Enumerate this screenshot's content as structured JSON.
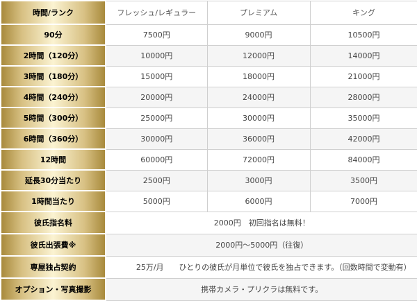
{
  "header": {
    "corner": "時間/ランク",
    "columns": [
      "フレッシュ/レギュラー",
      "プレミアム",
      "キング"
    ]
  },
  "rows": [
    {
      "label": "90分",
      "values": [
        "7500円",
        "9000円",
        "10500円"
      ]
    },
    {
      "label": "2時間（120分）",
      "values": [
        "10000円",
        "12000円",
        "14000円"
      ]
    },
    {
      "label": "3時間（180分）",
      "values": [
        "15000円",
        "18000円",
        "21000円"
      ]
    },
    {
      "label": "4時間（240分）",
      "values": [
        "20000円",
        "24000円",
        "28000円"
      ]
    },
    {
      "label": "5時間（300分）",
      "values": [
        "25000円",
        "30000円",
        "35000円"
      ]
    },
    {
      "label": "6時間（360分）",
      "values": [
        "30000円",
        "36000円",
        "42000円"
      ]
    },
    {
      "label": "12時間",
      "values": [
        "60000円",
        "72000円",
        "84000円"
      ]
    },
    {
      "label": "延長30分当たり",
      "values": [
        "2500円",
        "3000円",
        "3500円"
      ]
    },
    {
      "label": "1時間当たり",
      "values": [
        "5000円",
        "6000円",
        "7000円"
      ]
    }
  ],
  "extras": [
    {
      "label": "彼氏指名料",
      "text": "2000円　初回指名は無料！"
    },
    {
      "label": "彼氏出張費※",
      "text": "2000円～5000円（往復）"
    },
    {
      "label": "専屋独占契約",
      "text": "25万/月　　ひとりの彼氏が月単位で彼氏を独占できます。（回数時間で変動有）"
    },
    {
      "label": "オプション・写真撮影",
      "text": "携帯カメラ・プリクラは無料です。"
    }
  ],
  "colors": {
    "gold_dark": "#a88a3c",
    "gold_light": "#fbf3d2",
    "border": "#cfcfcf",
    "alt_row": "#f5f5f5"
  }
}
